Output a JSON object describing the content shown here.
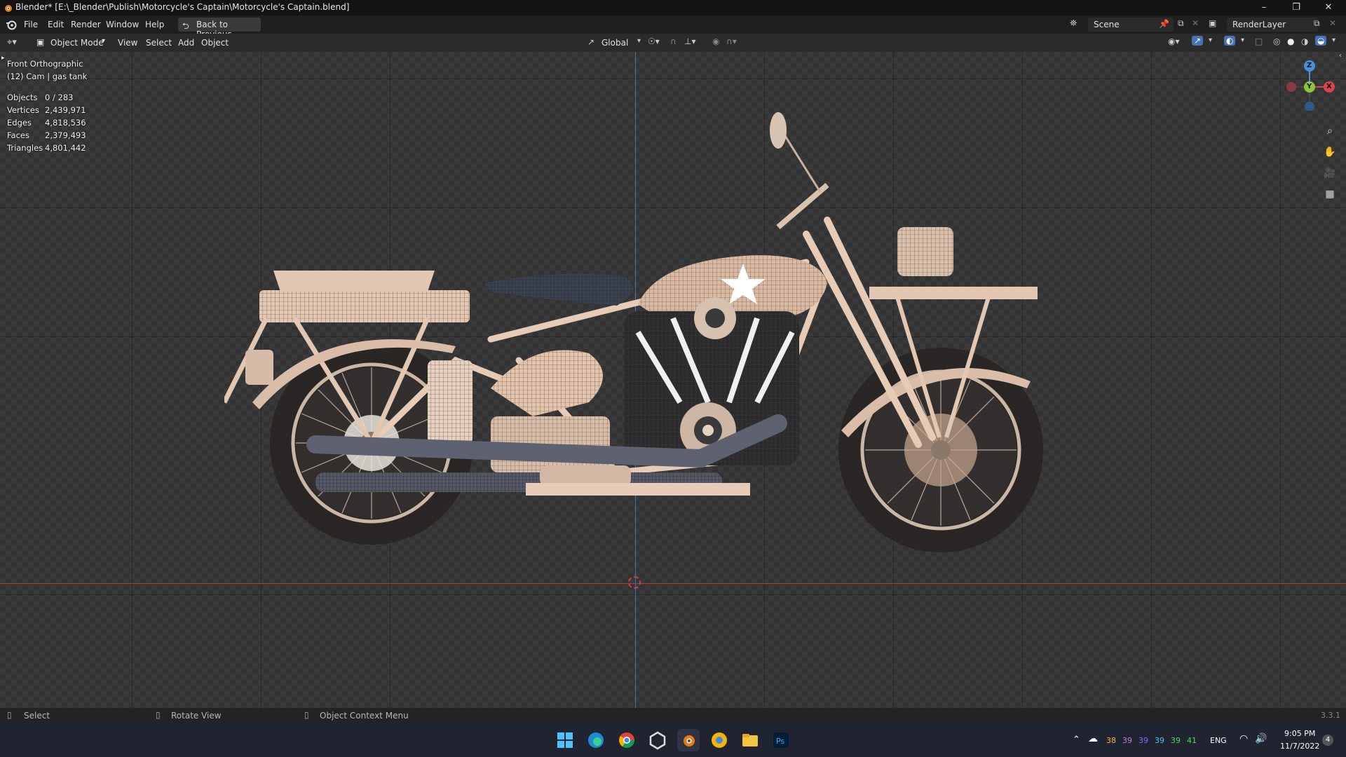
{
  "window": {
    "title": "Blender* [E:\\_Blender\\Publish\\Motorcycle's Captain\\Motorcycle's Captain.blend]",
    "minimize_icon": "minimize-icon",
    "restore_icon": "restore-icon",
    "close_icon": "close-icon"
  },
  "menubar": {
    "items": [
      "File",
      "Edit",
      "Render",
      "Window",
      "Help"
    ],
    "back_button": "Back to Previous",
    "scene_name": "Scene",
    "render_layer": "RenderLayer"
  },
  "header": {
    "mode": "Object Mode",
    "menus": [
      "View",
      "Select",
      "Add",
      "Object"
    ],
    "transform_orientation": "Global"
  },
  "viewport": {
    "view_name": "Front Orthographic",
    "collection_info": "(12) Cam | gas tank",
    "stats": [
      {
        "label": "Objects",
        "value": "0 / 283"
      },
      {
        "label": "Vertices",
        "value": "2,439,971"
      },
      {
        "label": "Edges",
        "value": "4,818,536"
      },
      {
        "label": "Faces",
        "value": "2,379,493"
      },
      {
        "label": "Triangles",
        "value": "4,801,442"
      }
    ],
    "gizmo_axes": {
      "z": "Z",
      "y": "Y",
      "x": "X"
    },
    "colors": {
      "x_axis": "#d8434e",
      "y_axis": "#8cc63f",
      "z_axis": "#4a8fd8",
      "ground_line": "#b43a3a",
      "vertical_line": "#3a7bb8"
    }
  },
  "statusbar": {
    "select": "Select",
    "rotate": "Rotate View",
    "context_menu": "Object Context Menu",
    "version": "3.3.1"
  },
  "taskbar": {
    "tray_numbers": [
      "38",
      "39",
      "39",
      "39",
      "39",
      "41"
    ],
    "language": "ENG",
    "time": "9:05 PM",
    "date": "11/7/2022",
    "notification_count": "4"
  }
}
